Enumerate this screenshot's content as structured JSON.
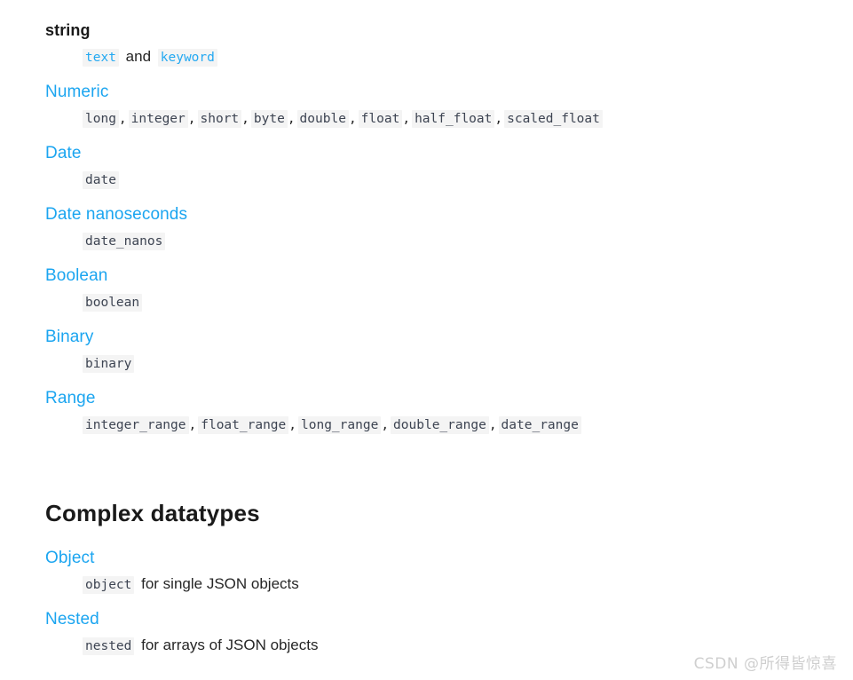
{
  "document": {
    "sections": [
      {
        "heading": "string",
        "heading_style": "plain",
        "items": [
          {
            "text": "text",
            "kind": "code-link"
          },
          {
            "text": "and",
            "kind": "plain"
          },
          {
            "text": "keyword",
            "kind": "code-link"
          }
        ]
      },
      {
        "heading": "Numeric",
        "heading_style": "link",
        "items": [
          {
            "text": "long",
            "kind": "code"
          },
          {
            "text": ",",
            "kind": "sep"
          },
          {
            "text": "integer",
            "kind": "code"
          },
          {
            "text": ",",
            "kind": "sep"
          },
          {
            "text": "short",
            "kind": "code"
          },
          {
            "text": ",",
            "kind": "sep"
          },
          {
            "text": "byte",
            "kind": "code"
          },
          {
            "text": ",",
            "kind": "sep"
          },
          {
            "text": "double",
            "kind": "code"
          },
          {
            "text": ",",
            "kind": "sep"
          },
          {
            "text": "float",
            "kind": "code"
          },
          {
            "text": ",",
            "kind": "sep"
          },
          {
            "text": "half_float",
            "kind": "code"
          },
          {
            "text": ",",
            "kind": "sep"
          },
          {
            "text": "scaled_float",
            "kind": "code"
          }
        ]
      },
      {
        "heading": "Date",
        "heading_style": "link",
        "items": [
          {
            "text": "date",
            "kind": "code"
          }
        ]
      },
      {
        "heading": "Date nanoseconds",
        "heading_style": "link",
        "items": [
          {
            "text": "date_nanos",
            "kind": "code"
          }
        ]
      },
      {
        "heading": "Boolean",
        "heading_style": "link",
        "items": [
          {
            "text": "boolean",
            "kind": "code"
          }
        ]
      },
      {
        "heading": "Binary",
        "heading_style": "link",
        "items": [
          {
            "text": "binary",
            "kind": "code"
          }
        ]
      },
      {
        "heading": "Range",
        "heading_style": "link",
        "items": [
          {
            "text": "integer_range",
            "kind": "code"
          },
          {
            "text": ",",
            "kind": "sep"
          },
          {
            "text": "float_range",
            "kind": "code"
          },
          {
            "text": ",",
            "kind": "sep"
          },
          {
            "text": "long_range",
            "kind": "code"
          },
          {
            "text": ",",
            "kind": "sep"
          },
          {
            "text": "double_range",
            "kind": "code"
          },
          {
            "text": ",",
            "kind": "sep"
          },
          {
            "text": "date_range",
            "kind": "code"
          }
        ]
      }
    ],
    "complex_title": "Complex datatypes",
    "complex_sections": [
      {
        "heading": "Object",
        "heading_style": "link",
        "items": [
          {
            "text": "object",
            "kind": "code"
          },
          {
            "text": "for single JSON objects",
            "kind": "plain"
          }
        ]
      },
      {
        "heading": "Nested",
        "heading_style": "link",
        "items": [
          {
            "text": "nested",
            "kind": "code"
          },
          {
            "text": "for arrays of JSON objects",
            "kind": "plain"
          }
        ]
      }
    ]
  },
  "watermark": {
    "text": "CSDN @所得皆惊喜"
  },
  "colors": {
    "link_blue": "#1ba5f0",
    "code_blue": "#24a9f2",
    "code_bg": "#f4f4f4",
    "code_fg": "#3d4452",
    "body_fg": "#262626",
    "heading_fg": "#1a1a1a",
    "watermark_fg": "#cfcfcf",
    "background": "#ffffff"
  }
}
